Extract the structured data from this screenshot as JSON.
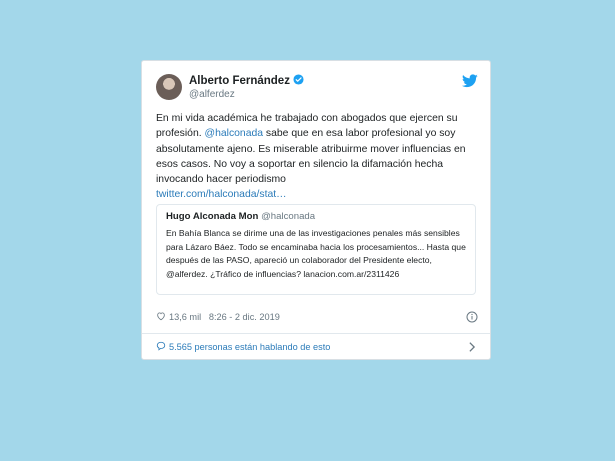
{
  "tweet": {
    "author_name": "Alberto Fernández",
    "author_handle": "@alferdez",
    "text_before": "En mi vida académica he trabajado con abogados que ejercen su profesión. ",
    "mention": "@halconada",
    "text_after": " sabe que en esa labor profesional yo soy absolutamente ajeno. Es miserable atribuirme mover influencias en esos casos. No voy a soportar en silencio la difamación hecha invocando hacer periodismo",
    "url": "twitter.com/halconada/stat…",
    "likes": "13,6 mil",
    "timestamp": "8:26 - 2 dic. 2019",
    "conversation": "5.565 personas están hablando de esto"
  },
  "quoted": {
    "author_name": "Hugo Alconada Mon",
    "author_handle": "@halconada",
    "text": "En Bahía Blanca se dirime una de las investigaciones penales más sensibles para Lázaro Báez. Todo se encaminaba hacia los procesamientos... Hasta que después de las PASO, apareció un colaborador del Presidente electo, @alferdez. ¿Tráfico de influencias? lanacion.com.ar/2311426"
  },
  "icons": {
    "verified": "verified-badge-icon",
    "bird": "twitter-bird-icon",
    "heart": "heart-icon",
    "info": "info-icon",
    "bubble": "comment-icon",
    "chevron": "chevron-right-icon"
  },
  "colors": {
    "background": "#a3d7ea",
    "link": "#2b7bb9",
    "verified": "#1da1f2"
  }
}
